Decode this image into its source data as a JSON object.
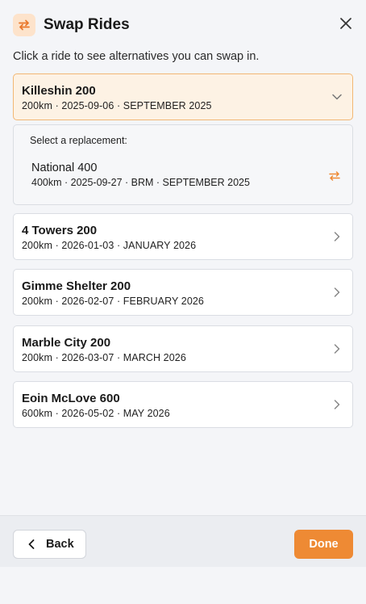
{
  "header": {
    "title": "Swap Rides",
    "icon": "swap-arrows-icon",
    "close_icon": "close-icon",
    "accent": "#ee8a34"
  },
  "intro": "Click a ride to see alternatives you can swap in.",
  "selected_ride": {
    "name": "Killeshin 200",
    "meta": "200km · 2025-09-06 · SEPTEMBER 2025",
    "expanded": true
  },
  "replacement": {
    "label": "Select a replacement:",
    "options": [
      {
        "name": "National 400",
        "meta": "400km · 2025-09-27 · BRM · SEPTEMBER 2025"
      }
    ]
  },
  "rides": [
    {
      "name": "4 Towers 200",
      "meta": "200km · 2026-01-03 · JANUARY 2026"
    },
    {
      "name": "Gimme Shelter 200",
      "meta": "200km · 2026-02-07 · FEBRUARY 2026"
    },
    {
      "name": "Marble City 200",
      "meta": "200km · 2026-03-07 · MARCH 2026"
    },
    {
      "name": "Eoin McLove 600",
      "meta": "600km · 2026-05-02 · MAY 2026"
    }
  ],
  "footer": {
    "back_label": "Back",
    "done_label": "Done"
  }
}
